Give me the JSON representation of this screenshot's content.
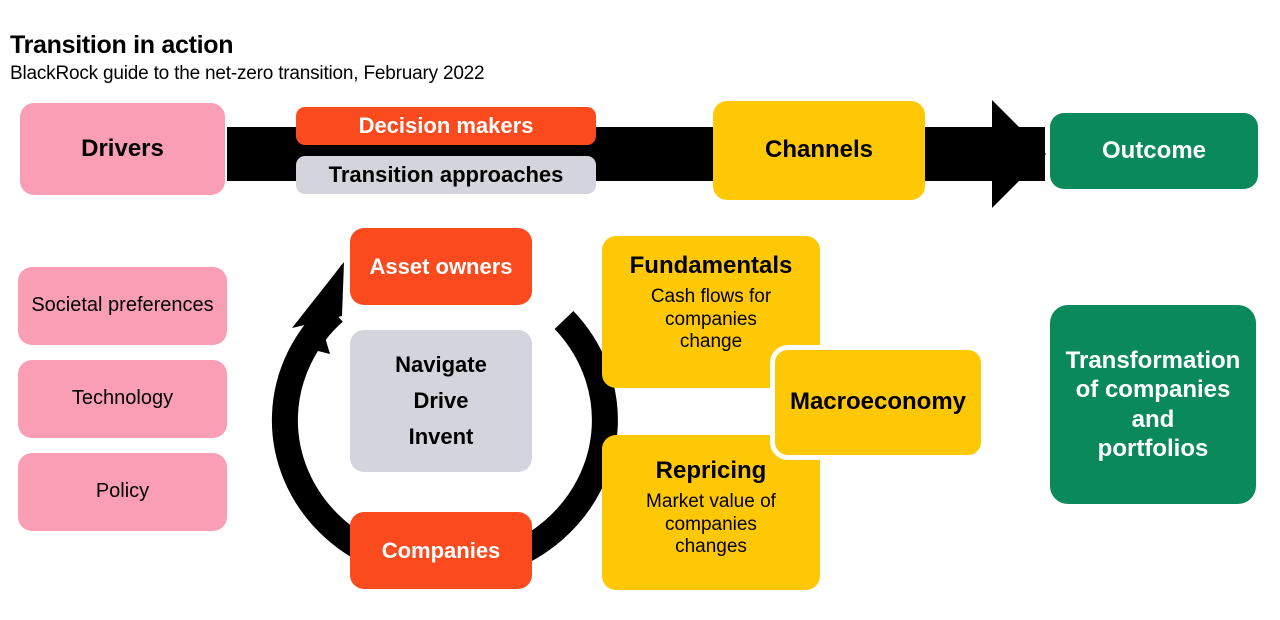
{
  "header": {
    "title": "Transition in action",
    "subtitle": "BlackRock guide to the net-zero transition, February 2022"
  },
  "top_row": {
    "drivers": "Drivers",
    "decision_makers": "Decision makers",
    "transition_approaches": "Transition approaches",
    "channels": "Channels",
    "outcome": "Outcome"
  },
  "drivers_column": {
    "items": [
      {
        "label": "Societal preferences"
      },
      {
        "label": "Technology"
      },
      {
        "label": "Policy"
      }
    ]
  },
  "cycle": {
    "asset_owners": "Asset owners",
    "companies": "Companies",
    "center": {
      "line1": "Navigate",
      "line2": "Drive",
      "line3": "Invent"
    }
  },
  "channels_detail": {
    "fundamentals": {
      "title": "Fundamentals",
      "body_line1": "Cash flows for",
      "body_line2": "companies",
      "body_line3": "change"
    },
    "repricing": {
      "title": "Repricing",
      "body_line1": "Market value of",
      "body_line2": "companies",
      "body_line3": "changes"
    },
    "macroeconomy": {
      "title": "Macroeconomy"
    }
  },
  "outcome_detail": {
    "line1": "Transformation",
    "line2": "of companies",
    "line3": "and",
    "line4": "portfolios"
  },
  "colors": {
    "pink": "#F99EB5",
    "orange": "#FB4A1E",
    "grey": "#D4D4DC",
    "yellow": "#FFC805",
    "green": "#0A8A5B",
    "black": "#000000",
    "white": "#FFFFFF"
  }
}
